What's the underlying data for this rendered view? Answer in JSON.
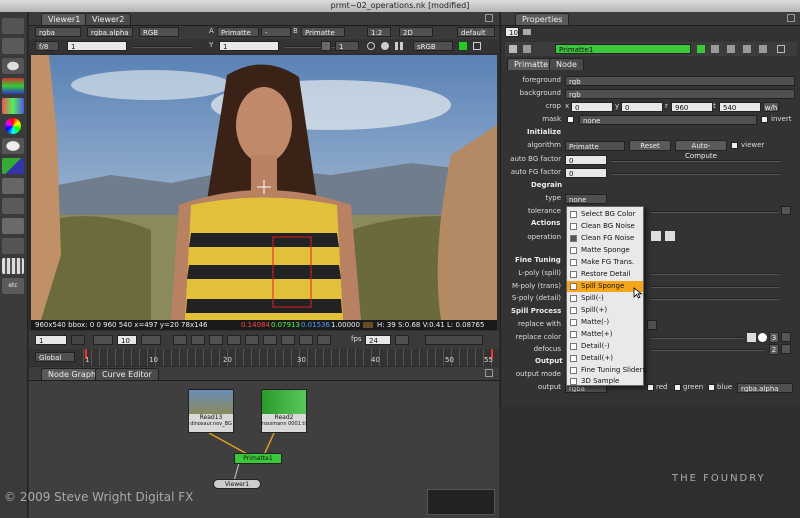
{
  "window": {
    "title": "prmt~02_operations.nk [modified]"
  },
  "viewer_tabs": [
    "Viewer1",
    "Viewer2"
  ],
  "viewer_bar1": {
    "channels": "rgba",
    "alpha": "rgba.alpha",
    "display": "RGB",
    "a_label": "A",
    "a_input": "Primatte",
    "a_op": "-",
    "b_label": "B",
    "b_input": "Primatte",
    "zoom": "1:2",
    "view": "2D",
    "lut": "default"
  },
  "viewer_bar2": {
    "fstop": "f/8",
    "frame": "1",
    "gamma_label": "Y",
    "gamma": "1",
    "frame2": "1",
    "colorspace": "sRGB"
  },
  "viewer_status": {
    "size": "960x540 bbox: 0 0 960 540 x=497 y=20 78x146",
    "r": "0.14084",
    "g": "0.07913",
    "b": "0.01536",
    "a": "1.00000",
    "hsv": "H: 39 S:0.68 V:0.41 L: 0.08765"
  },
  "timeline": {
    "frame": "1",
    "step": "10",
    "fps_label": "fps",
    "fps": "24",
    "ticks": [
      "1",
      "10",
      "20",
      "30",
      "40",
      "50",
      "55"
    ],
    "range": "Global"
  },
  "graph_tabs": [
    "Node Graph",
    "Curve Editor"
  ],
  "nodes": {
    "read13": "Read13",
    "read13_file": "dinosaur.nov_BG",
    "read2": "Read2",
    "read2_file": "rossmann 0001.tif",
    "primatte": "Primatte1",
    "viewer": "Viewer1"
  },
  "watermark": "© 2009 Steve Wright Digital FX",
  "logo": "THE FOUNDRY",
  "properties": {
    "tab": "Properties",
    "max_panels": "10",
    "node_name": "Primatte1",
    "subtabs": [
      "Primatte",
      "Node"
    ],
    "foreground_label": "foreground",
    "foreground": "rgb",
    "background_label": "background",
    "background": "rgb",
    "crop_label": "crop",
    "crop": {
      "x_label": "x",
      "x": "0",
      "y_label": "y",
      "y": "0",
      "r_label": "r",
      "r": "960",
      "t_label": "t",
      "t": "540",
      "wh": "w/h"
    },
    "mask_label": "mask",
    "mask": "none",
    "invert": "invert",
    "init_header": "Initialize",
    "algorithm_label": "algorithm",
    "algorithm": "Primatte",
    "reset": "Reset",
    "auto_compute": "Auto-Compute",
    "viewer": "viewer",
    "auto_bg_label": "auto BG factor",
    "auto_bg": "0",
    "auto_fg_label": "auto FG factor",
    "auto_fg": "0",
    "degrain_header": "Degrain",
    "type_label": "type",
    "type": "none",
    "tolerance_label": "tolerance",
    "actions_header": "Actions",
    "operation_label": "operation",
    "fine_header": "Fine Tuning",
    "lpoly_label": "L-poly (spill)",
    "mpoly_label": "M-poly (trans)",
    "spoly_label": "S-poly (detail)",
    "spill_header": "Spill Process",
    "replace_with_label": "replace with",
    "replace_color_label": "replace color",
    "replace_color_vals": [
      "3",
      "2"
    ],
    "defocus_label": "defocus",
    "output_header": "Output",
    "output_mode_label": "output mode",
    "output_label": "output",
    "output": "rgba",
    "red": "red",
    "green": "green",
    "blue": "blue",
    "alpha": "rgba.alpha"
  },
  "menu": [
    {
      "label": "Select BG Color",
      "checked": false
    },
    {
      "label": "Clean BG Noise",
      "checked": false
    },
    {
      "label": "Clean FG Noise",
      "checked": true
    },
    {
      "label": "Matte Sponge",
      "checked": false
    },
    {
      "label": "Make FG Trans.",
      "checked": false
    },
    {
      "label": "Restore Detail",
      "checked": false
    },
    {
      "label": "Spill Sponge",
      "checked": false,
      "highlighted": true
    },
    {
      "label": "Spill(-)",
      "checked": false
    },
    {
      "label": "Spill(+)",
      "checked": false
    },
    {
      "label": "Matte(-)",
      "checked": false
    },
    {
      "label": "Matte(+)",
      "checked": false
    },
    {
      "label": "Detail(-)",
      "checked": false
    },
    {
      "label": "Detail(+)",
      "checked": false
    },
    {
      "label": "Fine Tuning Sliders",
      "checked": false
    },
    {
      "label": "3D Sample",
      "checked": false
    }
  ],
  "colors": {
    "accent_green": "#3cc83c",
    "highlight": "#f7a51a",
    "panel": "#2e2e2e"
  }
}
